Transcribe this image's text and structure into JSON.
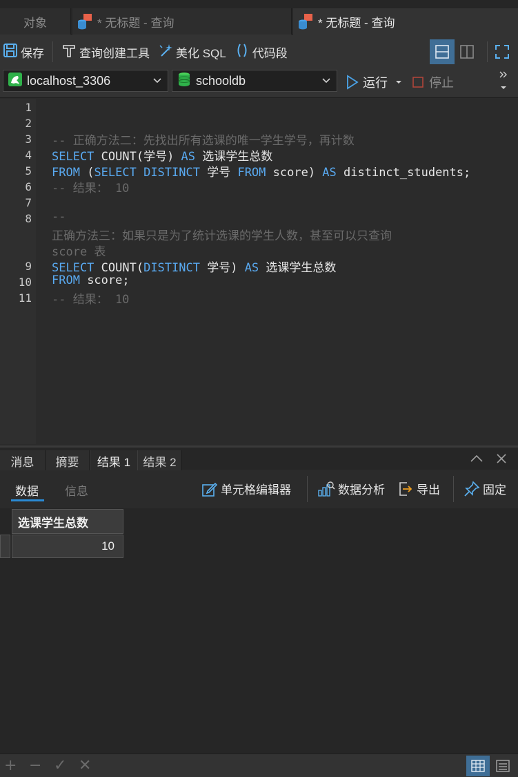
{
  "tabs": {
    "objects": "对象",
    "query1": "* 无标题 - 查询",
    "query2": "* 无标题 - 查询"
  },
  "toolbar": {
    "save": "保存",
    "query_builder": "查询创建工具",
    "beautify": "美化 SQL",
    "snippet": "代码段"
  },
  "connection": {
    "host": "localhost_3306",
    "database": "schooldb",
    "run": "运行",
    "stop": "停止"
  },
  "editor": {
    "line_numbers": [
      "1",
      "2",
      "3",
      "4",
      "5",
      "6",
      "7",
      "8",
      "9",
      "10",
      "11"
    ],
    "lines": {
      "l3": "-- 正确方法二：先找出所有选课的唯一学生学号，再计数",
      "l4_kw1": "SELECT",
      "l4_mid": " COUNT(学号) ",
      "l4_kw2": "AS",
      "l4_end": " 选课学生总数",
      "l5_kw1": "FROM",
      "l5_a": " (",
      "l5_kw2": "SELECT DISTINCT",
      "l5_b": " 学号 ",
      "l5_kw3": "FROM",
      "l5_c": " score) ",
      "l5_kw4": "AS",
      "l5_d": " distinct_students;",
      "l6": "-- 结果： 10",
      "l8a": "--",
      "l8b": "正确方法三：如果只是为了统计选课的学生人数，甚至可以只查询",
      "l8c": "score 表",
      "l9_kw1": "SELECT",
      "l9_a": " COUNT(",
      "l9_kw2": "DISTINCT",
      "l9_b": " 学号) ",
      "l9_kw3": "AS",
      "l9_c": " 选课学生总数",
      "l10_kw": "FROM",
      "l10_a": " score;",
      "l11": "-- 结果： 10"
    }
  },
  "result_tabs": [
    "消息",
    "摘要",
    "结果 1",
    "结果 2"
  ],
  "result_toolbar": {
    "data": "数据",
    "info": "信息",
    "cell_editor": "单元格编辑器",
    "data_analysis": "数据分析",
    "export": "导出",
    "pin": "固定"
  },
  "grid": {
    "columns": [
      "选课学生总数"
    ],
    "rows": [
      [
        "10"
      ]
    ]
  },
  "status": {
    "add": "+",
    "remove": "−",
    "apply": "✓",
    "cancel": "✕"
  },
  "colors": {
    "keyword": "#59a9f0",
    "comment": "#6a6a6a",
    "accent": "#2a8ad4"
  }
}
